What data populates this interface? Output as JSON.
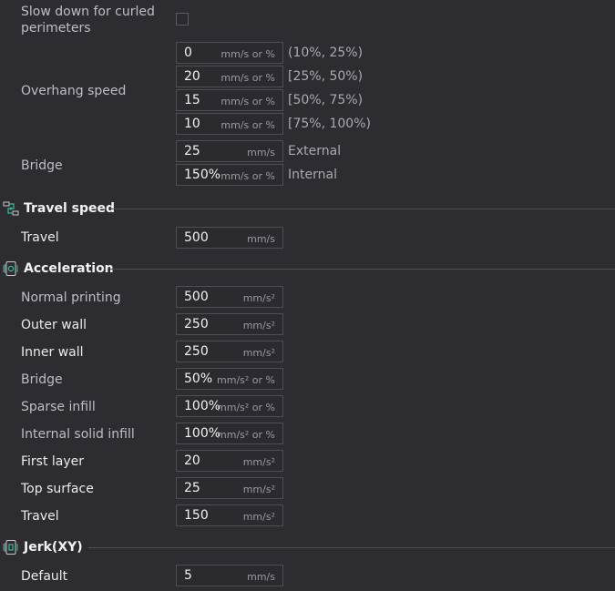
{
  "curled": {
    "label_line1": "Slow down for curled",
    "label_line2": "perimeters"
  },
  "overhang": {
    "label": "Overhang speed",
    "rows": [
      {
        "value": "0",
        "unit": "mm/s or %",
        "range": "(10%, 25%)"
      },
      {
        "value": "20",
        "unit": "mm/s or %",
        "range": "[25%, 50%)"
      },
      {
        "value": "15",
        "unit": "mm/s or %",
        "range": "[50%, 75%)"
      },
      {
        "value": "10",
        "unit": "mm/s or %",
        "range": "[75%, 100%)"
      }
    ]
  },
  "bridge": {
    "label": "Bridge",
    "external": {
      "value": "25",
      "unit": "mm/s",
      "side": "External"
    },
    "internal": {
      "value": "150%",
      "unit": "mm/s or %",
      "side": "Internal"
    }
  },
  "travel_section": {
    "title": "Travel speed",
    "travel": {
      "label": "Travel",
      "value": "500",
      "unit": "mm/s"
    }
  },
  "acceleration": {
    "title": "Acceleration",
    "rows": [
      {
        "label": "Normal printing",
        "value": "500",
        "unit": "mm/s²"
      },
      {
        "label": "Outer wall",
        "value": "250",
        "unit": "mm/s²"
      },
      {
        "label": "Inner wall",
        "value": "250",
        "unit": "mm/s²"
      },
      {
        "label": "Bridge",
        "value": "50%",
        "unit": "mm/s² or %"
      },
      {
        "label": "Sparse infill",
        "value": "100%",
        "unit": "mm/s² or %"
      },
      {
        "label": "Internal solid infill",
        "value": "100%",
        "unit": "mm/s² or %"
      },
      {
        "label": "First layer",
        "value": "20",
        "unit": "mm/s²"
      },
      {
        "label": "Top surface",
        "value": "25",
        "unit": "mm/s²"
      },
      {
        "label": "Travel",
        "value": "150",
        "unit": "mm/s²"
      }
    ]
  },
  "jerk": {
    "title": "Jerk(XY)",
    "default": {
      "label": "Default",
      "value": "5",
      "unit": "mm/s"
    }
  }
}
